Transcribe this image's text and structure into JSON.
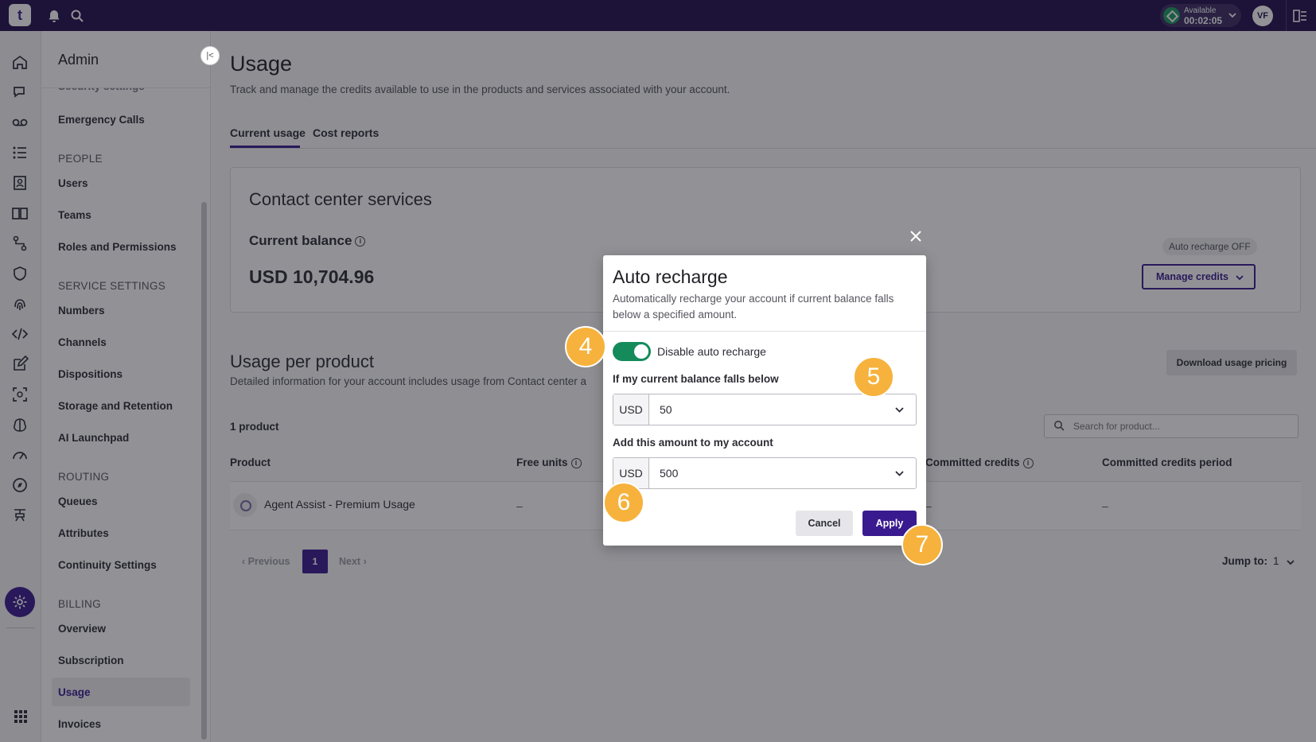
{
  "topbar": {
    "logo_text": "t",
    "status_label": "Available",
    "status_time": "00:02:05",
    "avatar_initials": "VF"
  },
  "sidebar": {
    "title": "Admin",
    "partial_item": "Security settings",
    "emergency": "Emergency Calls",
    "people_heading": "PEOPLE",
    "users": "Users",
    "teams": "Teams",
    "roles": "Roles and Permissions",
    "service_heading": "SERVICE SETTINGS",
    "numbers": "Numbers",
    "channels": "Channels",
    "dispositions": "Dispositions",
    "storage": "Storage and Retention",
    "ai": "AI Launchpad",
    "routing_heading": "ROUTING",
    "queues": "Queues",
    "attributes": "Attributes",
    "continuity": "Continuity Settings",
    "billing_heading": "BILLING",
    "overview": "Overview",
    "subscription": "Subscription",
    "usage": "Usage",
    "invoices": "Invoices"
  },
  "main": {
    "title": "Usage",
    "subtitle": "Track and manage the credits available to use in the products and services associated with your account.",
    "tab_current": "Current usage",
    "tab_cost": "Cost reports",
    "card_title": "Contact center services",
    "balance_label": "Current balance",
    "balance_value": "USD 10,704.96",
    "auto_badge": "Auto recharge OFF",
    "manage_credits": "Manage credits",
    "usage_title": "Usage per product",
    "usage_sub": "Detailed information for your account includes usage from Contact center a",
    "download_pricing": "Download usage pricing",
    "product_count": "1 product",
    "search_placeholder": "Search for product...",
    "col_product": "Product",
    "col_free": "Free units",
    "col_committed": "Committed credits",
    "col_period": "Committed credits period",
    "row_name": "Agent Assist - Premium Usage",
    "row_dash": "–",
    "previous": "Previous",
    "page": "1",
    "next": "Next",
    "jump_label": "Jump to:",
    "jump_value": "1"
  },
  "modal": {
    "title": "Auto recharge",
    "description": "Automatically recharge your account if current balance falls below a specified amount.",
    "toggle_label": "Disable auto recharge",
    "threshold_label": "If my current balance falls below",
    "threshold_currency": "USD",
    "threshold_value": "50",
    "amount_label": "Add this amount to my account",
    "amount_currency": "USD",
    "amount_value": "500",
    "cancel": "Cancel",
    "apply": "Apply"
  },
  "steps": [
    "4",
    "5",
    "6",
    "7"
  ],
  "colors": {
    "brand": "#230f4e",
    "accent": "#3a1b8f",
    "toggle_on": "#158b5c",
    "step_badge": "#f6b23c"
  },
  "icons": [
    "bell-icon",
    "search-icon",
    "home-icon",
    "chat-icon",
    "voicemail-icon",
    "list-icon",
    "contact-icon",
    "book-icon",
    "flow-icon",
    "shield-icon",
    "fingerprint-icon",
    "code-icon",
    "edit-icon",
    "scan-icon",
    "brain-icon",
    "gauge-icon",
    "compass-icon",
    "agent-icon",
    "gear-icon",
    "apps-grid-icon",
    "panel-icon",
    "close-icon",
    "chevron-down-icon",
    "info-icon"
  ]
}
